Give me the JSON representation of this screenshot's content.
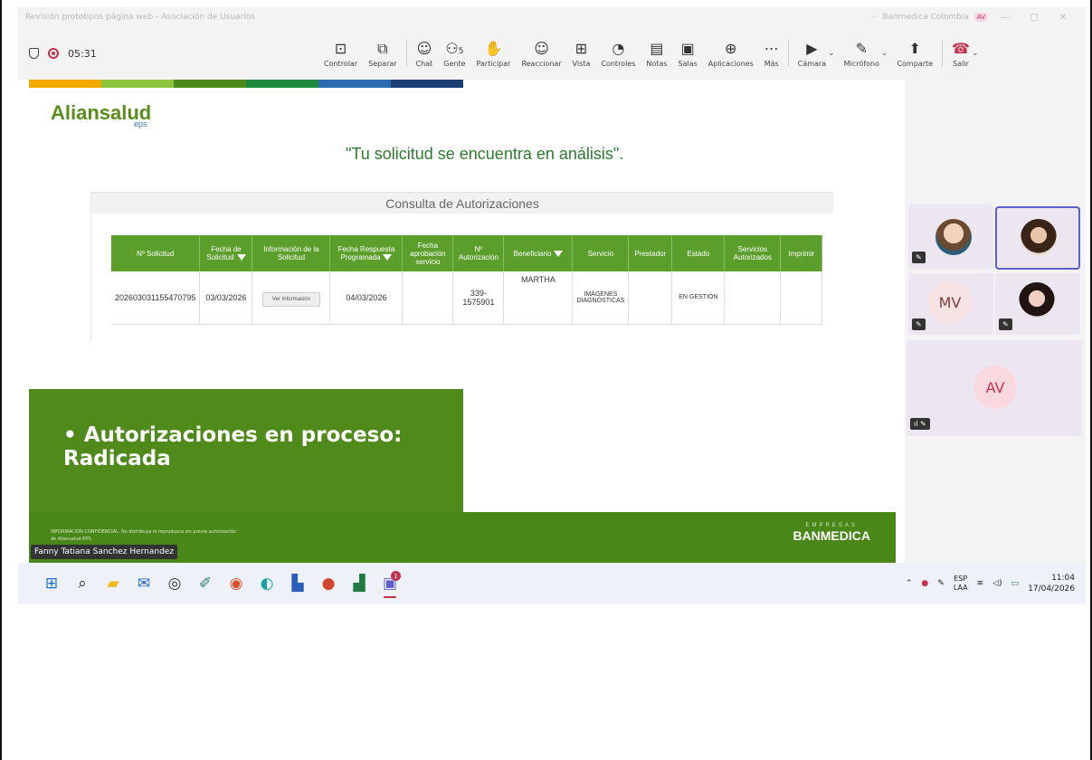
{
  "window": {
    "title": "Revisión prototipos página web - Asociación de Usuarios",
    "org": "Banmedica Colombia",
    "user_initials": "AV",
    "controls": [
      "—",
      "▢",
      "✕"
    ]
  },
  "meeting": {
    "timer": "05:31",
    "toolbar": [
      {
        "icon": "screen-share-control-icon",
        "glyph": "⊡",
        "label": "Controlar"
      },
      {
        "icon": "pop-out-icon",
        "glyph": "⧉",
        "label": "Separar"
      },
      {
        "icon": "chat-icon",
        "glyph": "☺",
        "label": "Chat"
      },
      {
        "icon": "people-icon",
        "glyph": "⚇",
        "label": "Gente",
        "count": "5"
      },
      {
        "icon": "raise-hand-icon",
        "glyph": "✋",
        "label": "Participar"
      },
      {
        "icon": "react-icon",
        "glyph": "☺",
        "label": "Reaccionar"
      },
      {
        "icon": "view-grid-icon",
        "glyph": "⊞",
        "label": "Vista"
      },
      {
        "icon": "controls-icon",
        "glyph": "◔",
        "label": "Controles"
      },
      {
        "icon": "notes-icon",
        "glyph": "▤",
        "label": "Notas"
      },
      {
        "icon": "rooms-icon",
        "glyph": "▣",
        "label": "Salas"
      },
      {
        "icon": "apps-icon",
        "glyph": "⊕",
        "label": "Aplicaciones"
      },
      {
        "icon": "more-icon",
        "glyph": "⋯",
        "label": "Más"
      }
    ],
    "media": [
      {
        "icon": "camera-off-icon",
        "glyph": "▶",
        "label": "Cámara"
      },
      {
        "icon": "mic-off-icon",
        "glyph": "✎",
        "label": "Micrófono"
      },
      {
        "icon": "share-icon",
        "glyph": "⬆",
        "label": "Comparte"
      }
    ],
    "leave_label": "Salir"
  },
  "slide": {
    "stripe_colors": [
      "#f2a900",
      "#8cc63f",
      "#4d8b1e",
      "#1f8a3b",
      "#2b6cb0",
      "#1c3f73"
    ],
    "logo": "Aliansalud",
    "logo_sub": "eps",
    "status_message": "\"Tu solicitud se encuentra en análisis\".",
    "panel_title": "Consulta de Autorizaciones",
    "table": {
      "headers": [
        "Nº Solicitud",
        "Fecha de Solicitud",
        "Información de la Solicitud",
        "Fecha Respuesta Programada",
        "Fecha aprobación servicio",
        "Nº Autorización",
        "Beneficiario",
        "Servicio",
        "Prestador",
        "Estado",
        "Servicios Autorizados",
        "Imprimir"
      ],
      "row": {
        "solicitud": "202603031155470795",
        "fecha": "03/03/2026",
        "ver_btn": "Ver Información",
        "respuesta": "04/03/2026",
        "aprobacion": "",
        "autorizacion": "339-1575901",
        "beneficiario": "MARTHA",
        "servicio": "IMÁGENES DIAGNÓSTICAS",
        "prestador": "",
        "estado": "EN GESTIÓN",
        "autorizados": "",
        "imprimir": ""
      }
    },
    "bullet_text": "• Autorizaciones en proceso: Radicada",
    "confidential": "INFORMACIÓN CONFIDENCIAL. No distribuya ni reproduzca sin previa autorización de Aliansalud EPS.",
    "brand_top": "EMPRESAS",
    "brand": "BANMEDICA"
  },
  "presenter_name": "Fanny Tatiana Sanchez Hernandez",
  "participants": [
    {
      "initials": "MV"
    },
    {
      "initials": "AV"
    }
  ],
  "taskbar": {
    "apps": [
      "start-icon",
      "search-icon",
      "file-explorer-icon",
      "outlook-icon",
      "copilot-icon",
      "whiteboard-icon",
      "chrome-icon",
      "edge-icon",
      "word-icon",
      "powerpoint-icon",
      "excel-icon",
      "teams-icon"
    ],
    "teams_badge": "1",
    "lang_top": "ESP",
    "lang_bottom": "LAA",
    "time": "11:04",
    "date": "17/04/2026"
  }
}
